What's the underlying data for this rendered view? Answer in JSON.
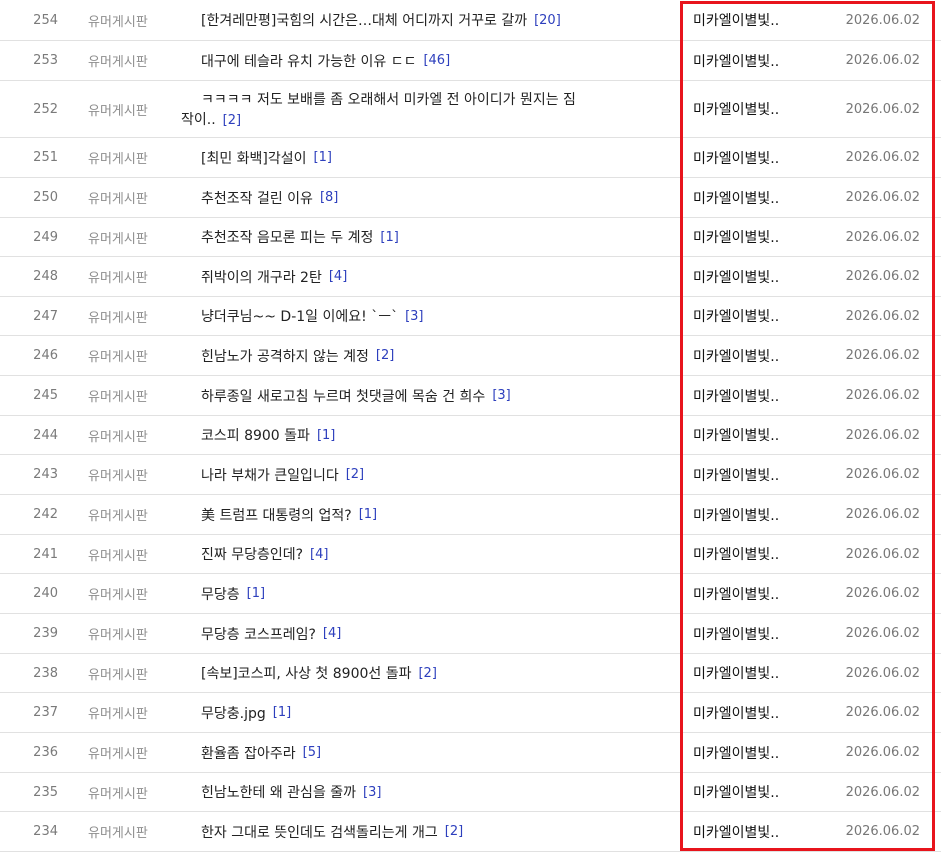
{
  "board": {
    "rows": [
      {
        "num": "254",
        "category": "유머게시판",
        "title": "[한겨레만평]국힘의 시간은…대체 어디까지 거꾸로 갈까",
        "comments": "[20]",
        "author": "미카엘이별빛..",
        "date": "2026.06.02"
      },
      {
        "num": "253",
        "category": "유머게시판",
        "title": "대구에 테슬라 유치 가능한 이유 ㄷㄷ",
        "comments": "[46]",
        "author": "미카엘이별빛..",
        "date": "2026.06.02"
      },
      {
        "num": "252",
        "category": "유머게시판",
        "title_line1": "ㅋㅋㅋㅋ 저도 보배를 좀 오래해서 미카엘 전 아이디가 뭔지는 짐",
        "title_line2": "작이..",
        "comments": "[2]",
        "author": "미카엘이별빛..",
        "date": "2026.06.02"
      },
      {
        "num": "251",
        "category": "유머게시판",
        "title": "[최민 화백]각설이",
        "comments": "[1]",
        "author": "미카엘이별빛..",
        "date": "2026.06.02"
      },
      {
        "num": "250",
        "category": "유머게시판",
        "title": "추천조작 걸린 이유",
        "comments": "[8]",
        "author": "미카엘이별빛..",
        "date": "2026.06.02"
      },
      {
        "num": "249",
        "category": "유머게시판",
        "title": "추천조작 음모론 피는 두 계정",
        "comments": "[1]",
        "author": "미카엘이별빛..",
        "date": "2026.06.02"
      },
      {
        "num": "248",
        "category": "유머게시판",
        "title": "쥐박이의 개구라 2탄",
        "comments": "[4]",
        "author": "미카엘이별빛..",
        "date": "2026.06.02"
      },
      {
        "num": "247",
        "category": "유머게시판",
        "title": "냥더쿠님~~ D-1일 이에요! `ㅡ`",
        "comments": "[3]",
        "author": "미카엘이별빛..",
        "date": "2026.06.02"
      },
      {
        "num": "246",
        "category": "유머게시판",
        "title": "힌남노가 공격하지 않는 계정",
        "comments": "[2]",
        "author": "미카엘이별빛..",
        "date": "2026.06.02"
      },
      {
        "num": "245",
        "category": "유머게시판",
        "title": "하루종일 새로고침 누르며 첫댓글에 목숨 건 희수",
        "comments": "[3]",
        "author": "미카엘이별빛..",
        "date": "2026.06.02"
      },
      {
        "num": "244",
        "category": "유머게시판",
        "title": "코스피 8900 돌파",
        "comments": "[1]",
        "author": "미카엘이별빛..",
        "date": "2026.06.02"
      },
      {
        "num": "243",
        "category": "유머게시판",
        "title": "나라 부채가 큰일입니다",
        "comments": "[2]",
        "author": "미카엘이별빛..",
        "date": "2026.06.02"
      },
      {
        "num": "242",
        "category": "유머게시판",
        "title": "美 트럼프 대통령의 업적?",
        "comments": "[1]",
        "author": "미카엘이별빛..",
        "date": "2026.06.02"
      },
      {
        "num": "241",
        "category": "유머게시판",
        "title": "진짜 무당층인데?",
        "comments": "[4]",
        "author": "미카엘이별빛..",
        "date": "2026.06.02"
      },
      {
        "num": "240",
        "category": "유머게시판",
        "title": "무당층",
        "comments": "[1]",
        "author": "미카엘이별빛..",
        "date": "2026.06.02"
      },
      {
        "num": "239",
        "category": "유머게시판",
        "title": "무당층 코스프레임?",
        "comments": "[4]",
        "author": "미카엘이별빛..",
        "date": "2026.06.02"
      },
      {
        "num": "238",
        "category": "유머게시판",
        "title": "[속보]코스피, 사상 첫 8900선 돌파",
        "comments": "[2]",
        "author": "미카엘이별빛..",
        "date": "2026.06.02"
      },
      {
        "num": "237",
        "category": "유머게시판",
        "title": "무당충.jpg",
        "comments": "[1]",
        "author": "미카엘이별빛..",
        "date": "2026.06.02"
      },
      {
        "num": "236",
        "category": "유머게시판",
        "title": "환율좀 잡아주라",
        "comments": "[5]",
        "author": "미카엘이별빛..",
        "date": "2026.06.02"
      },
      {
        "num": "235",
        "category": "유머게시판",
        "title": "힌남노한테 왜 관심을 줄까",
        "comments": "[3]",
        "author": "미카엘이별빛..",
        "date": "2026.06.02"
      },
      {
        "num": "234",
        "category": "유머게시판",
        "title": "한자 그대로 뜻인데도 검색돌리는게 개그",
        "comments": "[2]",
        "author": "미카엘이별빛..",
        "date": "2026.06.02"
      }
    ]
  },
  "colors": {
    "highlight_border": "#e8141c",
    "comment_count": "#2d3fbd",
    "row_divider": "#e1e1e1"
  }
}
